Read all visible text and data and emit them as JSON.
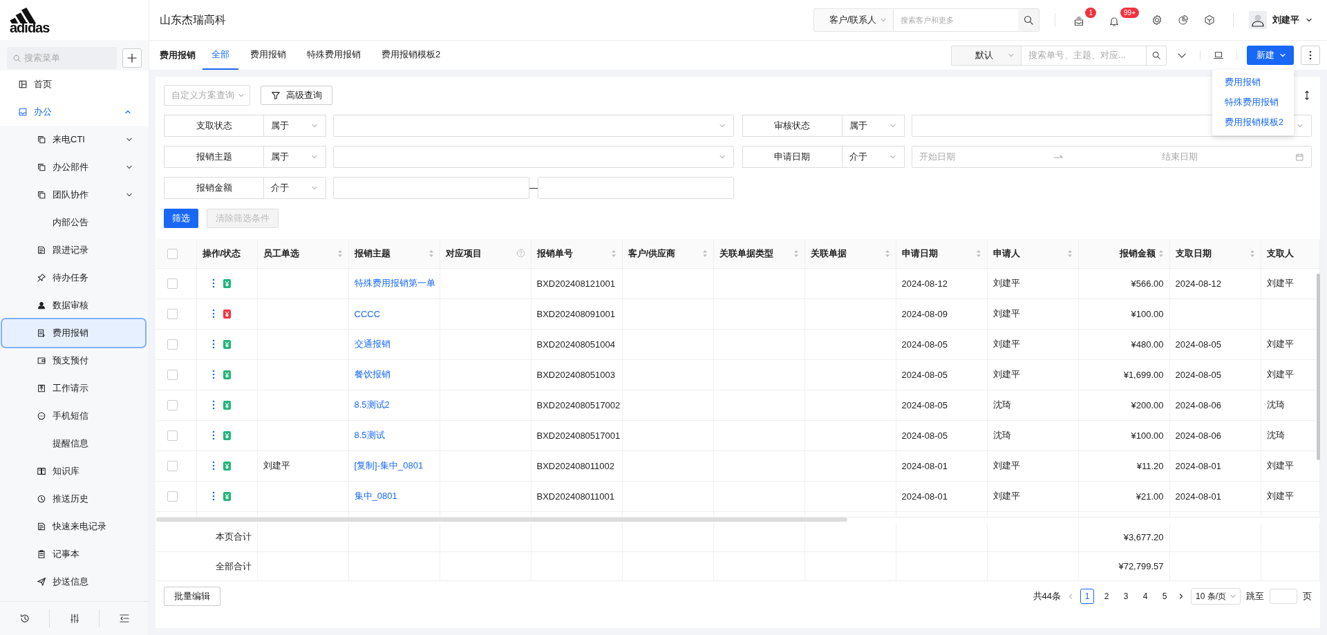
{
  "brand": {
    "logo": "adidas",
    "company": "山东杰瑞高科"
  },
  "header": {
    "search_scope": "客户/联系人",
    "search": {
      "placeholder": "搜索客户和更多"
    },
    "badges": [
      {
        "count": "1"
      },
      {
        "count": "99+"
      }
    ],
    "user": "刘建平"
  },
  "sidebar": {
    "search": {
      "placeholder": "搜索菜单"
    },
    "items": [
      {
        "label": "首页",
        "kind": "link",
        "selected": false
      },
      {
        "label": "办公",
        "kind": "group",
        "expanded": true,
        "selected": false,
        "children": [
          {
            "label": "来电CTI",
            "kind": "group",
            "expanded": false,
            "selected": false
          },
          {
            "label": "办公部件",
            "kind": "group",
            "expanded": false,
            "selected": false
          },
          {
            "label": "团队协作",
            "kind": "group",
            "expanded": false,
            "selected": false
          },
          {
            "label": "内部公告",
            "kind": "plain",
            "selected": false
          },
          {
            "label": "跟进记录",
            "kind": "link",
            "selected": false
          },
          {
            "label": "待办任务",
            "kind": "link",
            "selected": false
          },
          {
            "label": "数据审核",
            "kind": "link",
            "selected": false
          },
          {
            "label": "费用报销",
            "kind": "link",
            "selected": true
          },
          {
            "label": "预支预付",
            "kind": "link",
            "selected": false
          },
          {
            "label": "工作请示",
            "kind": "link",
            "selected": false
          },
          {
            "label": "手机短信",
            "kind": "link",
            "selected": false
          },
          {
            "label": "提醒信息",
            "kind": "plain",
            "selected": false
          },
          {
            "label": "知识库",
            "kind": "link",
            "selected": false
          },
          {
            "label": "推送历史",
            "kind": "link",
            "selected": false
          },
          {
            "label": "快速来电记录",
            "kind": "link",
            "selected": false
          },
          {
            "label": "记事本",
            "kind": "link",
            "selected": false
          },
          {
            "label": "抄送信息",
            "kind": "link",
            "selected": false
          }
        ]
      }
    ]
  },
  "page": {
    "title": "费用报销",
    "tabs": [
      {
        "label": "全部",
        "selected": true
      },
      {
        "label": "费用报销",
        "selected": false
      },
      {
        "label": "特殊费用报销",
        "selected": false
      },
      {
        "label": "费用报销模板2",
        "selected": false
      }
    ],
    "view_select": "默认",
    "search": {
      "placeholder": "搜索单号、主题、对应..."
    },
    "new_button": "新建",
    "new_menu": [
      "费用报销",
      "特殊费用报销",
      "费用报销模板2"
    ]
  },
  "filters": {
    "scheme_select": "自定义方案查询",
    "advanced_button": "高级查询",
    "fields": [
      {
        "label": "支取状态",
        "operator": "属于",
        "kind": "select"
      },
      {
        "label": "审核状态",
        "operator": "属于",
        "kind": "select"
      },
      {
        "label": "报销主题",
        "operator": "属于",
        "kind": "select"
      },
      {
        "label": "申请日期",
        "operator": "介于",
        "kind": "date_range",
        "start_placeholder": "开始日期",
        "end_placeholder": "结束日期"
      },
      {
        "label": "报销金额",
        "operator": "介于",
        "kind": "number_range"
      }
    ],
    "apply_button": "筛选",
    "clear_button": {
      "label": "清除筛选条件",
      "disabled": true
    }
  },
  "table": {
    "header_checked": false,
    "columns": [
      {
        "label": "操作/状态",
        "kind": "plain"
      },
      {
        "label": "员工单选",
        "kind": "sort"
      },
      {
        "label": "报销主题",
        "kind": "sort"
      },
      {
        "label": "对应项目",
        "kind": "help"
      },
      {
        "label": "报销单号",
        "kind": "sort"
      },
      {
        "label": "客户/供应商",
        "kind": "sort"
      },
      {
        "label": "关联单据类型",
        "kind": "sort"
      },
      {
        "label": "关联单据",
        "kind": "sort"
      },
      {
        "label": "申请日期",
        "kind": "sort"
      },
      {
        "label": "申请人",
        "kind": "sort"
      },
      {
        "label": "报销金额",
        "kind": "sort"
      },
      {
        "label": "支取日期",
        "kind": "sort"
      },
      {
        "label": "支取人",
        "kind": "plain"
      }
    ],
    "rows": [
      {
        "checked": false,
        "color": "#1fb57a",
        "subject": "特殊费用报销第一单",
        "number": "BXD202408121001",
        "date": "2024-08-12",
        "applicant": "刘建平",
        "amount": "¥566.00",
        "pay_date": "2024-08-12",
        "payee": "刘建平"
      },
      {
        "checked": false,
        "color": "#f5313d",
        "subject": "CCCC",
        "number": "BXD202408091001",
        "date": "2024-08-09",
        "applicant": "刘建平",
        "amount": "¥100.00"
      },
      {
        "checked": false,
        "color": "#1fb57a",
        "subject": "交通报销",
        "number": "BXD202408051004",
        "date": "2024-08-05",
        "applicant": "刘建平",
        "amount": "¥480.00",
        "pay_date": "2024-08-05",
        "payee": "刘建平"
      },
      {
        "checked": false,
        "color": "#1fb57a",
        "subject": "餐饮报销",
        "number": "BXD202408051003",
        "date": "2024-08-05",
        "applicant": "刘建平",
        "amount": "¥1,699.00",
        "pay_date": "2024-08-05",
        "payee": "刘建平"
      },
      {
        "checked": false,
        "color": "#1fb57a",
        "subject": "8.5测试2",
        "number": "BXD2024080517002",
        "date": "2024-08-05",
        "applicant": "沈琦",
        "amount": "¥200.00",
        "pay_date": "2024-08-06",
        "payee": "沈琦"
      },
      {
        "checked": false,
        "color": "#1fb57a",
        "subject": "8.5测试",
        "number": "BXD2024080517001",
        "date": "2024-08-05",
        "applicant": "沈琦",
        "amount": "¥100.00",
        "pay_date": "2024-08-06",
        "payee": "沈琦"
      },
      {
        "checked": false,
        "color": "#1fb57a",
        "employee": "刘建平",
        "subject": "[复制]-集中_0801",
        "number": "BXD202408011002",
        "date": "2024-08-01",
        "applicant": "刘建平",
        "amount": "¥11.20",
        "pay_date": "2024-08-01",
        "payee": "刘建平"
      },
      {
        "checked": false,
        "color": "#1fb57a",
        "subject": "集中_0801",
        "number": "BXD202408011001",
        "date": "2024-08-01",
        "applicant": "刘建平",
        "amount": "¥21.00",
        "pay_date": "2024-08-01",
        "payee": "刘建平"
      }
    ],
    "totals": [
      {
        "label": "本页合计",
        "amount": "¥3,677.20"
      },
      {
        "label": "全部合计",
        "amount": "¥72,799.57"
      }
    ]
  },
  "footer": {
    "batch_button": "批量编辑",
    "total": "共44条",
    "pages": [
      {
        "label": "1",
        "selected": true
      },
      {
        "label": "2",
        "selected": false
      },
      {
        "label": "3",
        "selected": false
      },
      {
        "label": "4",
        "selected": false
      },
      {
        "label": "5",
        "selected": false
      }
    ],
    "page_size": "10 条/页",
    "jump_label": "跳至",
    "jump_suffix": "页"
  }
}
